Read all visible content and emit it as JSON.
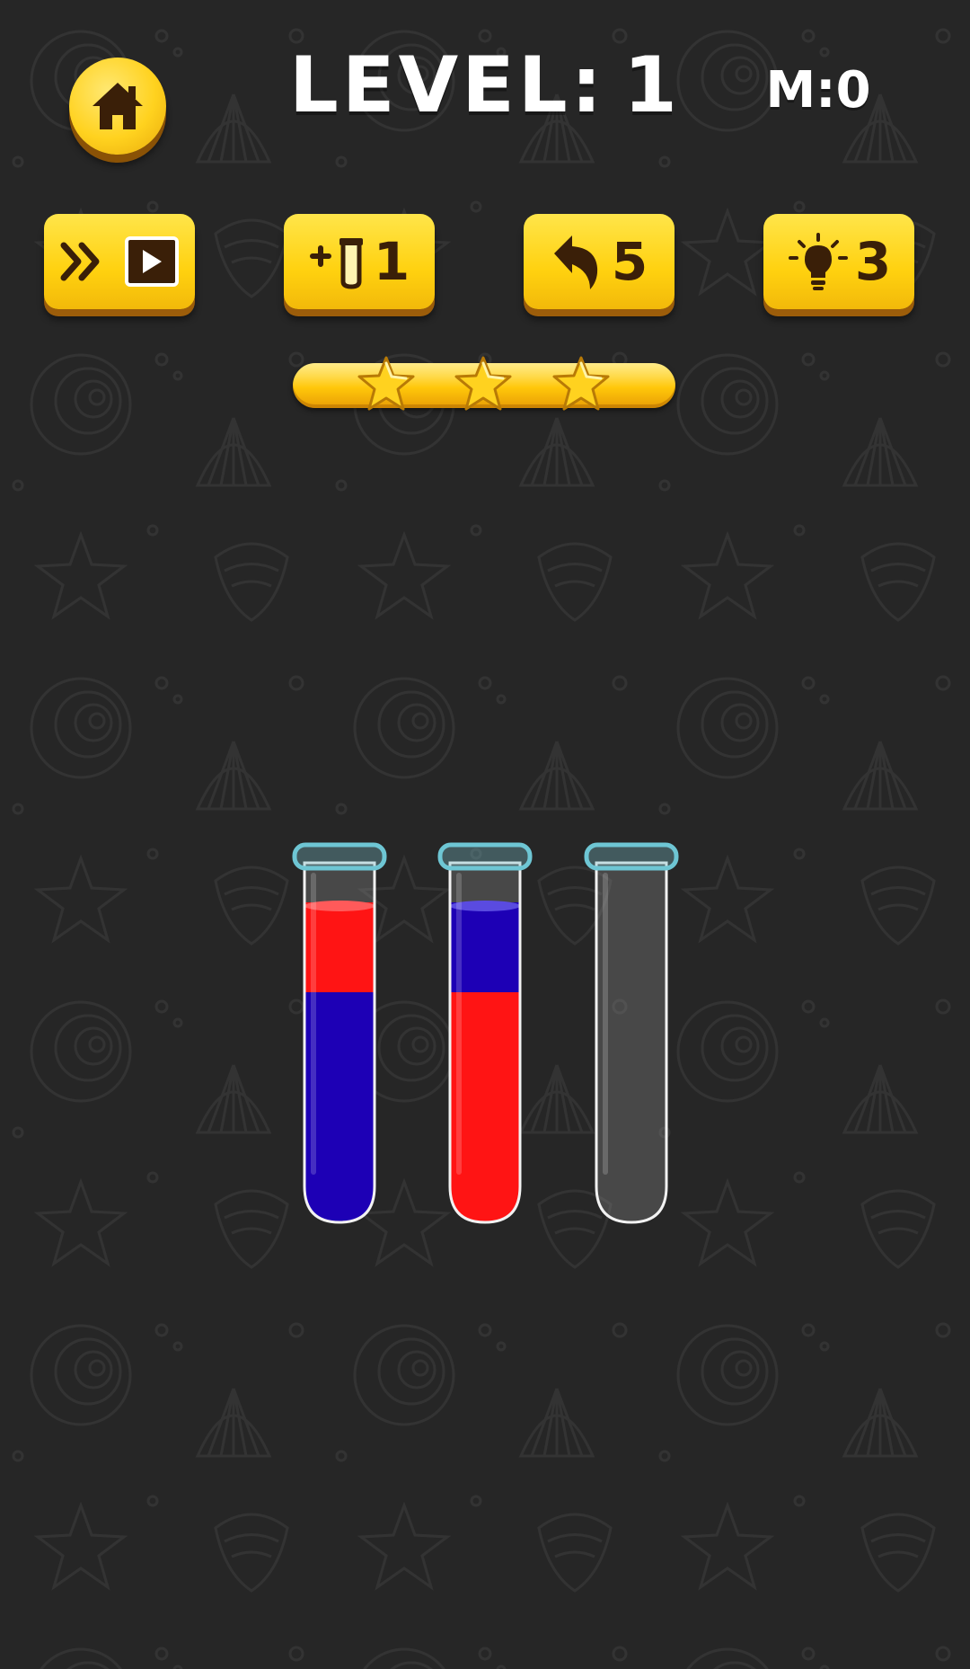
{
  "hud": {
    "level_label": "LEVEL:",
    "level_number": "1",
    "moves_label": "M:0"
  },
  "actions": {
    "skip_level": {
      "icon": "fast-forward-icon",
      "badge_icon": "play-video-icon"
    },
    "add_tube": {
      "icon": "plus-tube-icon",
      "count": "1"
    },
    "undo": {
      "icon": "undo-arrow-icon",
      "count": "5"
    },
    "hint": {
      "icon": "lightbulb-icon",
      "count": "3"
    }
  },
  "stars": {
    "earned": 3,
    "total": 3,
    "progress": 1.0
  },
  "colors": {
    "accent_yellow": "#ffd10f",
    "button_text": "#3a1f08",
    "background": "#262626",
    "red": "#ff1414",
    "blue": "#1d00b5",
    "tube_rim": "#6ec6d4"
  },
  "tubes": [
    {
      "name": "tube-1",
      "segments_bottom_to_top": [
        "blue",
        "red"
      ]
    },
    {
      "name": "tube-2",
      "segments_bottom_to_top": [
        "red",
        "blue"
      ]
    },
    {
      "name": "tube-3",
      "segments_bottom_to_top": []
    }
  ]
}
